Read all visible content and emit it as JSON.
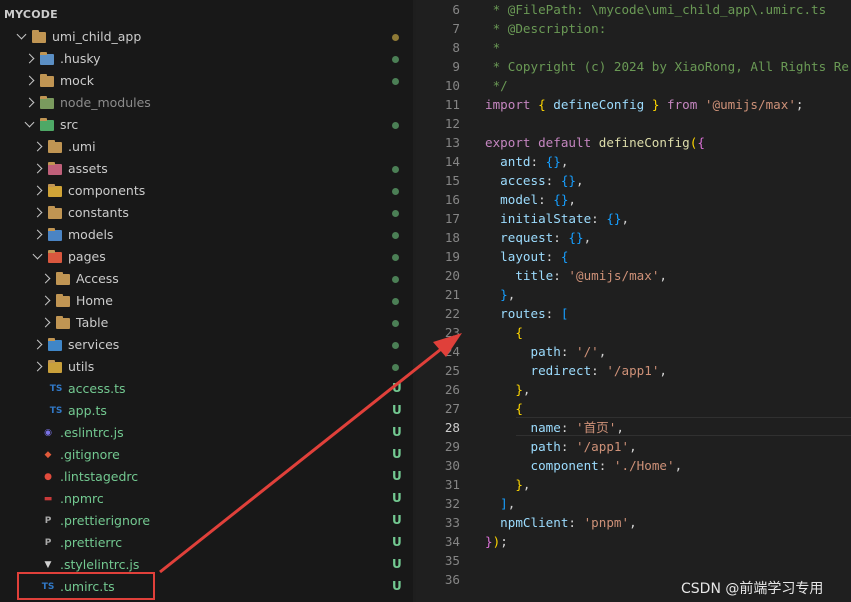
{
  "explorer": {
    "header": "MYCODE",
    "items": [
      {
        "label": "umi_child_app",
        "icon": "folder-icon",
        "state": "open",
        "depth": 0,
        "status": "modified"
      },
      {
        "label": ".husky",
        "icon": "husky-folder-icon",
        "state": "closed",
        "depth": 1,
        "status": "dot"
      },
      {
        "label": "mock",
        "icon": "folder-icon",
        "state": "closed",
        "depth": 1,
        "status": "dot"
      },
      {
        "label": "node_modules",
        "icon": "node-folder-icon",
        "state": "closed",
        "depth": 1,
        "status": "none",
        "dim": true
      },
      {
        "label": "src",
        "icon": "src-folder-icon",
        "state": "open",
        "depth": 1,
        "status": "dot"
      },
      {
        "label": ".umi",
        "icon": "folder-icon",
        "state": "closed",
        "depth": 2,
        "status": "none"
      },
      {
        "label": "assets",
        "icon": "assets-folder-icon",
        "state": "closed",
        "depth": 2,
        "status": "dot"
      },
      {
        "label": "components",
        "icon": "components-folder-icon",
        "state": "closed",
        "depth": 2,
        "status": "dot"
      },
      {
        "label": "constants",
        "icon": "folder-icon",
        "state": "closed",
        "depth": 2,
        "status": "dot"
      },
      {
        "label": "models",
        "icon": "models-folder-icon",
        "state": "closed",
        "depth": 2,
        "status": "dot"
      },
      {
        "label": "pages",
        "icon": "pages-folder-icon",
        "state": "open",
        "depth": 2,
        "status": "dot"
      },
      {
        "label": "Access",
        "icon": "folder-icon",
        "state": "closed",
        "depth": 3,
        "status": "dot"
      },
      {
        "label": "Home",
        "icon": "folder-icon",
        "state": "closed",
        "depth": 3,
        "status": "dot"
      },
      {
        "label": "Table",
        "icon": "folder-icon",
        "state": "closed",
        "depth": 3,
        "status": "dot"
      },
      {
        "label": "services",
        "icon": "services-folder-icon",
        "state": "closed",
        "depth": 2,
        "status": "dot"
      },
      {
        "label": "utils",
        "icon": "utils-folder-icon",
        "state": "closed",
        "depth": 2,
        "status": "dot"
      },
      {
        "label": "access.ts",
        "icon": "ts-file-icon",
        "state": "file",
        "depth": 2,
        "status": "U"
      },
      {
        "label": "app.ts",
        "icon": "ts-file-icon",
        "state": "file",
        "depth": 2,
        "status": "U"
      },
      {
        "label": ".eslintrc.js",
        "icon": "eslint-file-icon",
        "state": "file",
        "depth": 1,
        "status": "U"
      },
      {
        "label": ".gitignore",
        "icon": "git-file-icon",
        "state": "file",
        "depth": 1,
        "status": "U"
      },
      {
        "label": ".lintstagedrc",
        "icon": "lintstaged-file-icon",
        "state": "file",
        "depth": 1,
        "status": "U"
      },
      {
        "label": ".npmrc",
        "icon": "npm-file-icon",
        "state": "file",
        "depth": 1,
        "status": "U"
      },
      {
        "label": ".prettierignore",
        "icon": "prettier-file-icon",
        "state": "file",
        "depth": 1,
        "status": "U"
      },
      {
        "label": ".prettierrc",
        "icon": "prettier-file-icon",
        "state": "file",
        "depth": 1,
        "status": "U"
      },
      {
        "label": ".stylelintrc.js",
        "icon": "stylelint-file-icon",
        "state": "file",
        "depth": 1,
        "status": "U"
      },
      {
        "label": ".umirc.ts",
        "icon": "ts-file-icon",
        "state": "file",
        "depth": 1,
        "status": "U"
      }
    ]
  },
  "editor": {
    "active_line": "28",
    "lines": [
      {
        "n": "6",
        "tokens": [
          [
            "c-comment",
            " * @FilePath: \\mycode\\umi_child_app\\.umirc.ts"
          ]
        ]
      },
      {
        "n": "7",
        "tokens": [
          [
            "c-comment",
            " * @Description:"
          ]
        ]
      },
      {
        "n": "8",
        "tokens": [
          [
            "c-comment",
            " *"
          ]
        ]
      },
      {
        "n": "9",
        "tokens": [
          [
            "c-comment",
            " * Copyright (c) 2024 by XiaoRong, All Rights Re"
          ]
        ]
      },
      {
        "n": "10",
        "tokens": [
          [
            "c-comment",
            " */"
          ]
        ]
      },
      {
        "n": "11",
        "tokens": [
          [
            "c-kw",
            "import "
          ],
          [
            "c-brace1",
            "{ "
          ],
          [
            "c-prop",
            "defineConfig"
          ],
          [
            "c-brace1",
            " }"
          ],
          [
            "c-kw",
            " from "
          ],
          [
            "c-str",
            "'@umijs/max'"
          ],
          [
            "c-punc",
            ";"
          ]
        ]
      },
      {
        "n": "12",
        "tokens": []
      },
      {
        "n": "13",
        "tokens": [
          [
            "c-kw",
            "export default "
          ],
          [
            "c-fn",
            "defineConfig"
          ],
          [
            "c-brace1",
            "("
          ],
          [
            "c-brace2",
            "{"
          ]
        ]
      },
      {
        "n": "14",
        "tokens": [
          [
            "c-prop",
            "  antd"
          ],
          [
            "c-punc",
            ": "
          ],
          [
            "c-brace3",
            "{}"
          ],
          [
            "c-punc",
            ","
          ]
        ]
      },
      {
        "n": "15",
        "tokens": [
          [
            "c-prop",
            "  access"
          ],
          [
            "c-punc",
            ": "
          ],
          [
            "c-brace3",
            "{}"
          ],
          [
            "c-punc",
            ","
          ]
        ]
      },
      {
        "n": "16",
        "tokens": [
          [
            "c-prop",
            "  model"
          ],
          [
            "c-punc",
            ": "
          ],
          [
            "c-brace3",
            "{}"
          ],
          [
            "c-punc",
            ","
          ]
        ]
      },
      {
        "n": "17",
        "tokens": [
          [
            "c-prop",
            "  initialState"
          ],
          [
            "c-punc",
            ": "
          ],
          [
            "c-brace3",
            "{}"
          ],
          [
            "c-punc",
            ","
          ]
        ]
      },
      {
        "n": "18",
        "tokens": [
          [
            "c-prop",
            "  request"
          ],
          [
            "c-punc",
            ": "
          ],
          [
            "c-brace3",
            "{}"
          ],
          [
            "c-punc",
            ","
          ]
        ]
      },
      {
        "n": "19",
        "tokens": [
          [
            "c-prop",
            "  layout"
          ],
          [
            "c-punc",
            ": "
          ],
          [
            "c-brace3",
            "{"
          ]
        ]
      },
      {
        "n": "20",
        "tokens": [
          [
            "c-prop",
            "    title"
          ],
          [
            "c-punc",
            ": "
          ],
          [
            "c-str",
            "'@umijs/max'"
          ],
          [
            "c-punc",
            ","
          ]
        ]
      },
      {
        "n": "21",
        "tokens": [
          [
            "c-brace3",
            "  }"
          ],
          [
            "c-punc",
            ","
          ]
        ]
      },
      {
        "n": "22",
        "tokens": [
          [
            "c-prop",
            "  routes"
          ],
          [
            "c-punc",
            ": "
          ],
          [
            "c-brace3",
            "["
          ]
        ]
      },
      {
        "n": "23",
        "tokens": [
          [
            "c-brace1",
            "    {"
          ]
        ]
      },
      {
        "n": "24",
        "tokens": [
          [
            "c-prop",
            "      path"
          ],
          [
            "c-punc",
            ": "
          ],
          [
            "c-str",
            "'/'"
          ],
          [
            "c-punc",
            ","
          ]
        ]
      },
      {
        "n": "25",
        "tokens": [
          [
            "c-prop",
            "      redirect"
          ],
          [
            "c-punc",
            ": "
          ],
          [
            "c-str",
            "'/app1'"
          ],
          [
            "c-punc",
            ","
          ]
        ]
      },
      {
        "n": "26",
        "tokens": [
          [
            "c-brace1",
            "    }"
          ],
          [
            "c-punc",
            ","
          ]
        ]
      },
      {
        "n": "27",
        "tokens": [
          [
            "c-brace1",
            "    {"
          ]
        ]
      },
      {
        "n": "28",
        "tokens": [
          [
            "c-prop",
            "      name"
          ],
          [
            "c-punc",
            ": "
          ],
          [
            "c-str",
            "'首页'"
          ],
          [
            "c-punc",
            ","
          ]
        ]
      },
      {
        "n": "29",
        "tokens": [
          [
            "c-prop",
            "      path"
          ],
          [
            "c-punc",
            ": "
          ],
          [
            "c-str",
            "'/app1'"
          ],
          [
            "c-punc",
            ","
          ]
        ]
      },
      {
        "n": "30",
        "tokens": [
          [
            "c-prop",
            "      component"
          ],
          [
            "c-punc",
            ": "
          ],
          [
            "c-str",
            "'./Home'"
          ],
          [
            "c-punc",
            ","
          ]
        ]
      },
      {
        "n": "31",
        "tokens": [
          [
            "c-brace1",
            "    }"
          ],
          [
            "c-punc",
            ","
          ]
        ]
      },
      {
        "n": "32",
        "tokens": [
          [
            "c-brace3",
            "  ]"
          ],
          [
            "c-punc",
            ","
          ]
        ]
      },
      {
        "n": "33",
        "tokens": [
          [
            "c-prop",
            "  npmClient"
          ],
          [
            "c-punc",
            ": "
          ],
          [
            "c-str",
            "'pnpm'"
          ],
          [
            "c-punc",
            ","
          ]
        ]
      },
      {
        "n": "34",
        "tokens": [
          [
            "c-brace2",
            "}"
          ],
          [
            "c-brace1",
            ")"
          ],
          [
            "c-punc",
            ";"
          ]
        ]
      },
      {
        "n": "35",
        "tokens": []
      },
      {
        "n": "36",
        "tokens": []
      }
    ]
  },
  "watermark": "CSDN @前端学习专用",
  "colors": {
    "annotation_red": "#e0403a",
    "untracked_green": "#73c991",
    "folder": "#c09553",
    "ts_blue": "#3178c6"
  }
}
